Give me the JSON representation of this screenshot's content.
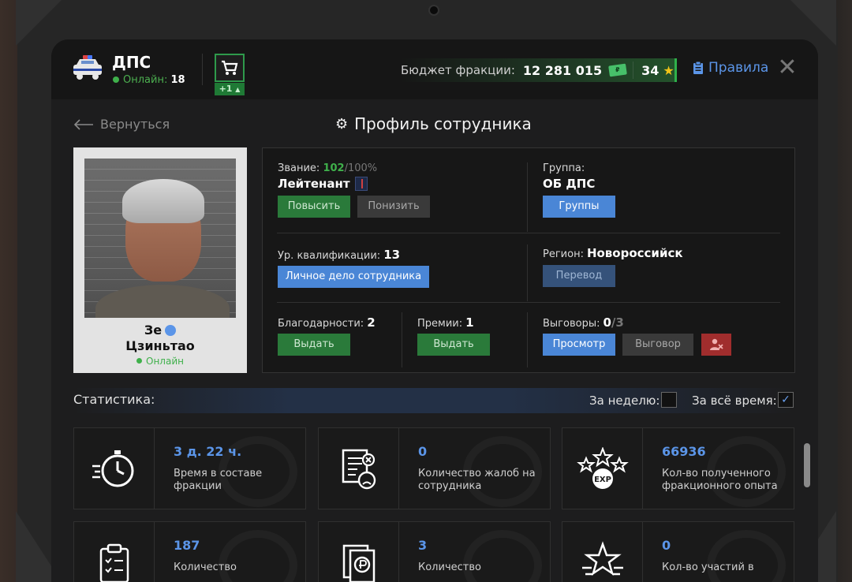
{
  "header": {
    "faction_name": "ДПС",
    "online_label": "Онлайн:",
    "online_count": "18",
    "cart_badge": "+1",
    "budget_label": "Бюджет фракции:",
    "budget_value": "12 281 015",
    "stars_value": "34",
    "rules_label": "Правила"
  },
  "nav": {
    "back_label": "Вернуться",
    "page_title": "Профиль сотрудника"
  },
  "employee": {
    "name_first": "Зе",
    "name_last": "Цзиньтао",
    "status": "Онлайн"
  },
  "info": {
    "rank_label": "Звание:",
    "rank_progress": "102",
    "rank_max": "/100%",
    "rank_name": "Лейтенант",
    "promote_btn": "Повысить",
    "demote_btn": "Понизить",
    "group_label": "Группа:",
    "group_value": "ОБ ДПС",
    "groups_btn": "Группы",
    "qual_label": "Ур. квалификации:",
    "qual_value": "13",
    "personal_file_btn": "Личное дело сотрудника",
    "region_label": "Регион:",
    "region_value": "Новороссийск",
    "transfer_btn": "Перевод",
    "thanks_label": "Благодарности:",
    "thanks_value": "2",
    "thanks_btn": "Выдать",
    "bonus_label": "Премии:",
    "bonus_value": "1",
    "bonus_btn": "Выдать",
    "reprimand_label": "Выговоры:",
    "reprimand_value": "0",
    "reprimand_max": "/3",
    "view_btn": "Просмотр",
    "reprimand_btn": "Выговор"
  },
  "stats": {
    "title": "Статистика:",
    "week_label": "За неделю:",
    "alltime_label": "За всё время:",
    "week_checked": false,
    "alltime_checked": true,
    "cards": [
      {
        "icon": "stopwatch-icon",
        "value": "3 д. 22 ч.",
        "desc": "Время в составе фракции"
      },
      {
        "icon": "complaint-document-icon",
        "value": "0",
        "desc": "Количество жалоб на сотрудника"
      },
      {
        "icon": "exp-stars-icon",
        "value": "66936",
        "desc": "Кол-во полученного фракционного опыта"
      },
      {
        "icon": "clipboard-checklist-icon",
        "value": "187",
        "desc": "Количество"
      },
      {
        "icon": "ruble-document-icon",
        "value": "3",
        "desc": "Количество"
      },
      {
        "icon": "star-award-icon",
        "value": "0",
        "desc": "Кол-во участий в"
      }
    ]
  },
  "colors": {
    "accent_blue": "#5b95e8",
    "green": "#3fb04b",
    "button_green": "#2a7a3a",
    "button_blue": "#4a86d6",
    "button_red": "#a02d2d"
  }
}
